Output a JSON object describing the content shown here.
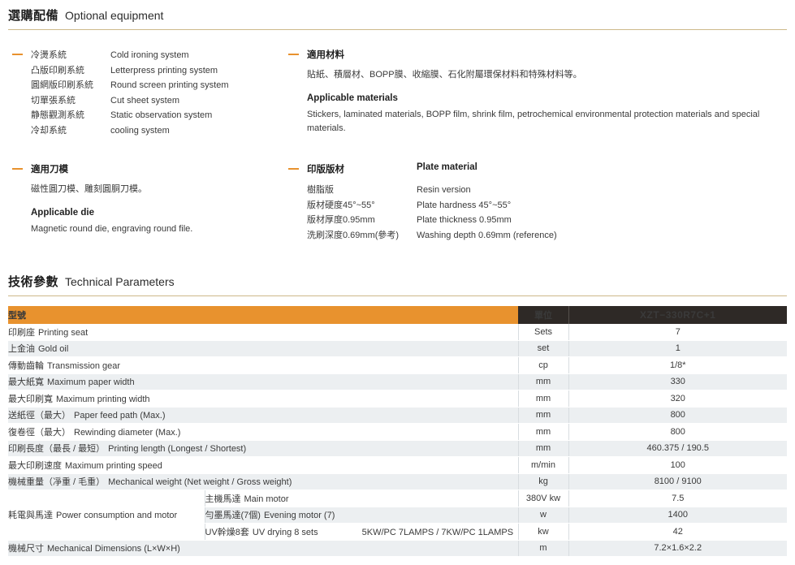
{
  "sections": {
    "optional": {
      "title_cn": "選購配備",
      "title_en": "Optional equipment",
      "blocks": {
        "systems": {
          "items": [
            {
              "cn": "冷燙系統",
              "en": "Cold ironing system"
            },
            {
              "cn": "凸版印刷系統",
              "en": "Letterpress printing system"
            },
            {
              "cn": "圓網版印刷系統",
              "en": "Round screen printing system"
            },
            {
              "cn": "切單張系統",
              "en": "Cut sheet system"
            },
            {
              "cn": "静態觀測系統",
              "en": "Static observation system"
            },
            {
              "cn": "冷却系統",
              "en": "cooling system"
            }
          ]
        },
        "materials": {
          "title_cn": "適用材料",
          "body_cn": "貼紙、積層材、BOPP膜、收縮膜、石化附屬環保材料和特殊材料等。",
          "title_en": "Applicable materials",
          "body_en": "Stickers, laminated materials, BOPP film, shrink film, petrochemical environmental protection materials and special materials."
        },
        "die": {
          "title_cn": "適用刀模",
          "body_cn": "磁性圓刀模、雕刻圓胴刀模。",
          "title_en": "Applicable die",
          "body_en": "Magnetic round die, engraving round file."
        },
        "plate": {
          "title_cn": "印版版材",
          "title_en": "Plate material",
          "rows": [
            {
              "cn": "樹脂版",
              "en": "Resin version"
            },
            {
              "cn": "版材硬度45°~55°",
              "en": "Plate hardness 45°~55°"
            },
            {
              "cn": "版材厚度0.95mm",
              "en": "Plate thickness 0.95mm"
            },
            {
              "cn": "洗刷深度0.69mm(參考)",
              "en": "Washing depth 0.69mm (reference)"
            }
          ]
        }
      }
    },
    "technical": {
      "title_cn": "技術參數",
      "title_en": "Technical Parameters",
      "table": {
        "header": {
          "model_label": "型號",
          "unit_label": "單位",
          "model_value": "XZT−330R7C+1"
        },
        "rows": [
          {
            "cn": "印刷座",
            "en": "Printing seat",
            "unit": "Sets",
            "value": "7"
          },
          {
            "cn": "上金油",
            "en": "Gold oil",
            "unit": "set",
            "value": "1"
          },
          {
            "cn": "傳動齒輪",
            "en": "Transmission gear",
            "unit": "cp",
            "value": "1/8*"
          },
          {
            "cn": "最大紙寬",
            "en": "Maximum paper width",
            "unit": "mm",
            "value": "330"
          },
          {
            "cn": "最大印刷寬",
            "en": "Maximum printing width",
            "unit": "mm",
            "value": "320"
          },
          {
            "cn": "送紙徑（最大）",
            "en": "Paper feed path (Max.)",
            "unit": "mm",
            "value": "800"
          },
          {
            "cn": "復卷徑（最大）",
            "en": "Rewinding diameter (Max.)",
            "unit": "mm",
            "value": "800"
          },
          {
            "cn": "印刷長度（最長 / 最短）",
            "en": "Printing length (Longest / Shortest)",
            "unit": "mm",
            "value": "460.375 / 190.5"
          },
          {
            "cn": "最大印刷速度",
            "en": "Maximum printing speed",
            "unit": "m/min",
            "value": "100"
          },
          {
            "cn": "機械重量（凈重 / 毛重）",
            "en": "Mechanical weight (Net weight / Gross weight)",
            "unit": "kg",
            "value": "8100 / 9100"
          }
        ],
        "power_group": {
          "cn": "耗電與馬達",
          "en": "Power consumption and motor",
          "rows": [
            {
              "cn": "主機馬達",
              "en": "Main motor",
              "extra": "",
              "unit": "380V  kw",
              "value": "7.5"
            },
            {
              "cn": "勻墨馬達(7個)",
              "en": "Evening motor (7)",
              "extra": "",
              "unit": "w",
              "value": "1400"
            },
            {
              "cn": "UV幹燥8套",
              "en": "UV drying 8 sets",
              "extra": "5KW/PC 7LAMPS  /  7KW/PC 1LAMPS",
              "unit": "kw",
              "value": "42"
            }
          ]
        },
        "last_row": {
          "cn": "機械尺寸",
          "en": "Mechanical Dimensions (L×W×H)",
          "unit": "m",
          "value": "7.2×1.6×2.2"
        }
      }
    }
  },
  "colors": {
    "accent_orange": "#e8922e",
    "header_dark": "#2e2926",
    "rule_tan": "#cdb98a",
    "row_stripe": "#eceff1"
  }
}
